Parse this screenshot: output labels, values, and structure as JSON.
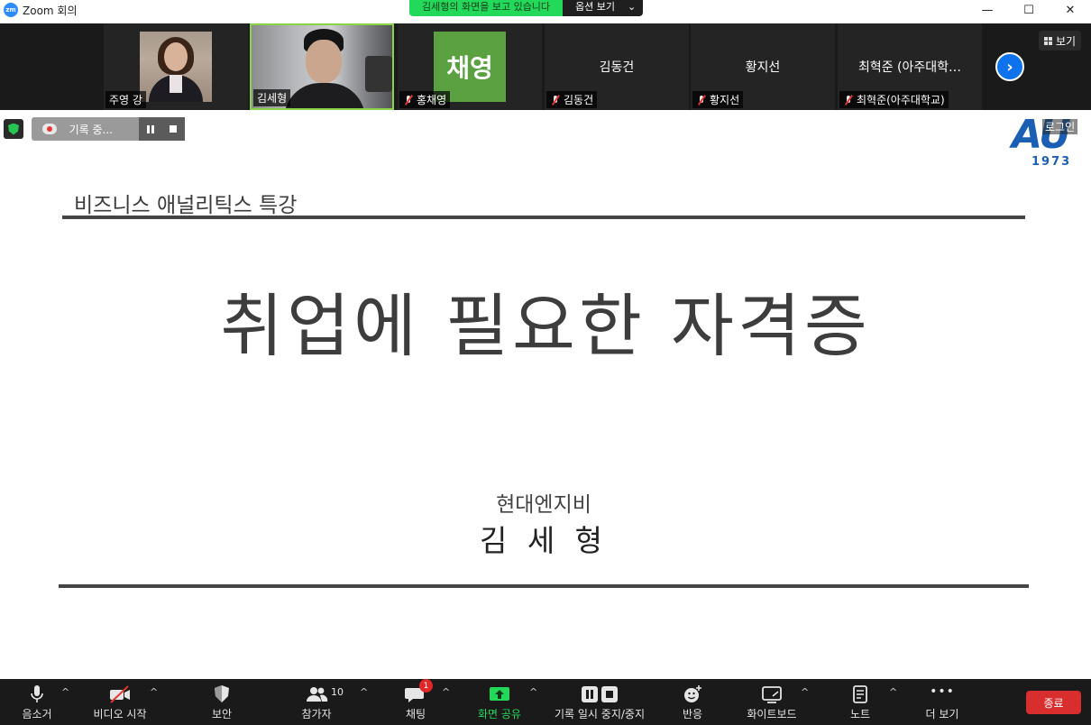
{
  "window": {
    "app_logo_text": "zm",
    "title": "Zoom 회의",
    "controls": {
      "minimize": "—",
      "maximize": "☐",
      "close": "✕"
    }
  },
  "share_banner": {
    "text": "김세형의 화면을 보고 있습니다",
    "options_label": "옵션 보기",
    "options_caret": "⌄"
  },
  "participants": [
    {
      "name": "주영 강",
      "display": "photo",
      "muted": false
    },
    {
      "name": "김세형",
      "display": "photo",
      "muted": false,
      "active": true
    },
    {
      "name": "홍채영",
      "display": "avatar",
      "avatar_text": "채영",
      "muted": true
    },
    {
      "name": "김동건",
      "display": "name",
      "center_label": "김동건",
      "muted": true
    },
    {
      "name": "황지선",
      "display": "name",
      "center_label": "황지선",
      "muted": true
    },
    {
      "name": "최혁준(아주대학교)",
      "display": "name",
      "center_label": "최혁준 (아주대학…",
      "muted": true
    }
  ],
  "strip": {
    "next_glyph": "›",
    "view_label": "보기"
  },
  "recording": {
    "status": "기록 중..."
  },
  "slide": {
    "logo_letters": "AU",
    "logo_year": "1973",
    "login_tag": "로그인",
    "course_title": "비즈니스 애널리틱스 특강",
    "headline": "취업에 필요한 자격증",
    "company": "현대엔지비",
    "presenter": "김 세 형"
  },
  "toolbar": {
    "mute": "음소거",
    "video": "비디오 시작",
    "security": "보안",
    "participants": "참가자",
    "participants_count": "10",
    "chat": "채팅",
    "chat_badge": "1",
    "share": "화면 공유",
    "record": "기록 일시 중지/중지",
    "reactions": "반응",
    "whiteboard": "화이트보드",
    "notes": "노트",
    "more": "더 보기",
    "more_glyph": "•••",
    "end": "종료",
    "caret": "^"
  },
  "colors": {
    "share_green": "#23d959",
    "zoom_blue": "#0e72ed",
    "end_red": "#d92e2e",
    "au_blue": "#1a5fb4",
    "avatar_green": "#5ba142"
  }
}
